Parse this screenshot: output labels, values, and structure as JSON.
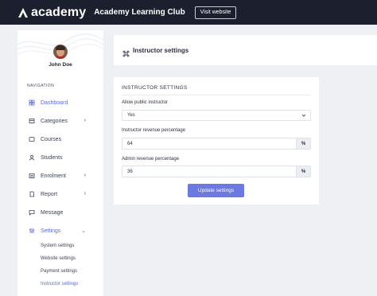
{
  "topbar": {
    "logo_text": "academy",
    "site_name": "Academy Learning Club",
    "visit_label": "Visit website"
  },
  "sidebar": {
    "user_name": "John Doe",
    "nav_heading": "NAVIGATION",
    "items": [
      {
        "label": "Dashboard",
        "icon": "dashboard-icon"
      },
      {
        "label": "Categories",
        "icon": "categories-icon"
      },
      {
        "label": "Courses",
        "icon": "courses-icon"
      },
      {
        "label": "Students",
        "icon": "students-icon"
      },
      {
        "label": "Enrolment",
        "icon": "enrolment-icon"
      },
      {
        "label": "Report",
        "icon": "report-icon"
      },
      {
        "label": "Message",
        "icon": "message-icon"
      },
      {
        "label": "Settings",
        "icon": "settings-icon"
      }
    ],
    "sub_items": [
      {
        "label": "System settings"
      },
      {
        "label": "Website settings"
      },
      {
        "label": "Payment settings"
      },
      {
        "label": "Instructor settings"
      }
    ]
  },
  "header": {
    "title": "Instructor settings"
  },
  "form": {
    "title": "INSTRUCTOR SETTINGS",
    "public_label": "Allow public instructor",
    "public_value": "Yes",
    "instructor_rev_label": "Instructor revenue percentage",
    "instructor_rev_value": "64",
    "admin_rev_label": "Admin revenue percentage",
    "admin_rev_value": "36",
    "percent_symbol": "%",
    "submit_label": "Update settings"
  },
  "colors": {
    "topbar": "#1b1f2e",
    "accent": "#5c6bda",
    "button": "#6c7ae0"
  }
}
